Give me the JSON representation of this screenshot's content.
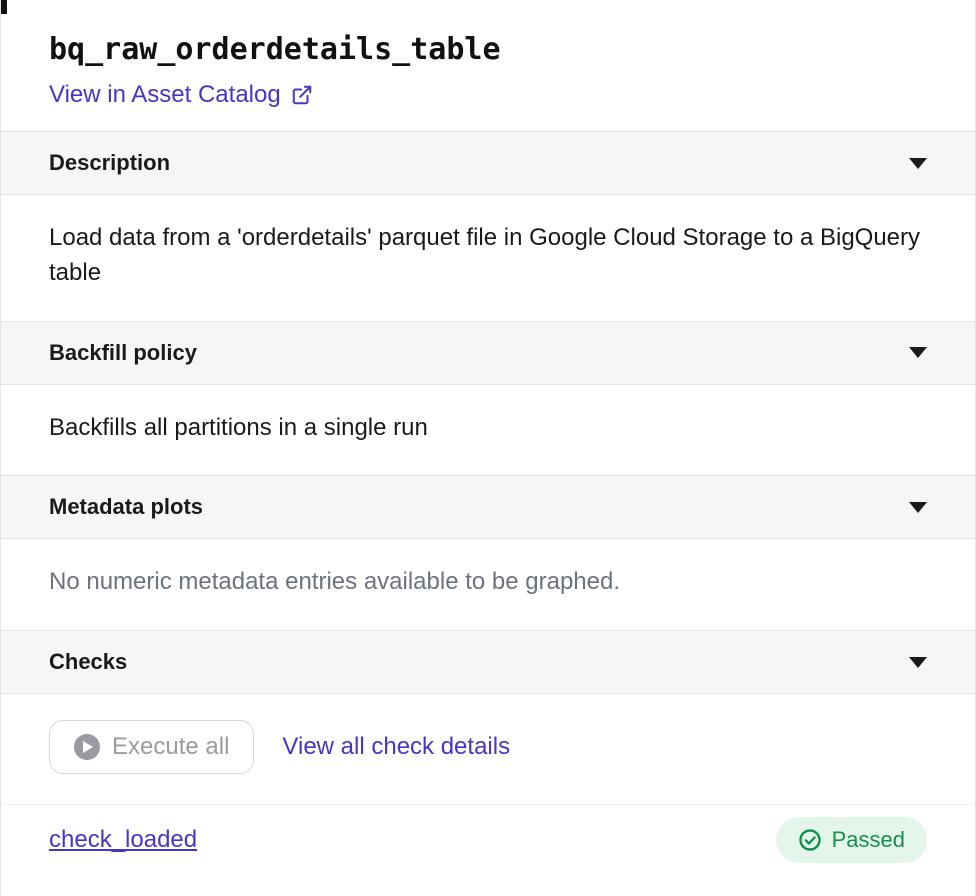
{
  "header": {
    "title": "bq_raw_orderdetails_table",
    "catalog_link_label": "View in Asset Catalog"
  },
  "sections": {
    "description": {
      "title": "Description",
      "body": "Load data from a 'orderdetails' parquet file in Google Cloud Storage to a BigQuery table"
    },
    "backfill": {
      "title": "Backfill policy",
      "body": "Backfills all partitions in a single run"
    },
    "metadata_plots": {
      "title": "Metadata plots",
      "body": "No numeric metadata entries available to be graphed."
    },
    "checks": {
      "title": "Checks",
      "execute_all_label": "Execute all",
      "view_all_label": "View all check details",
      "items": [
        {
          "name": "check_loaded",
          "status_label": "Passed"
        }
      ]
    }
  }
}
